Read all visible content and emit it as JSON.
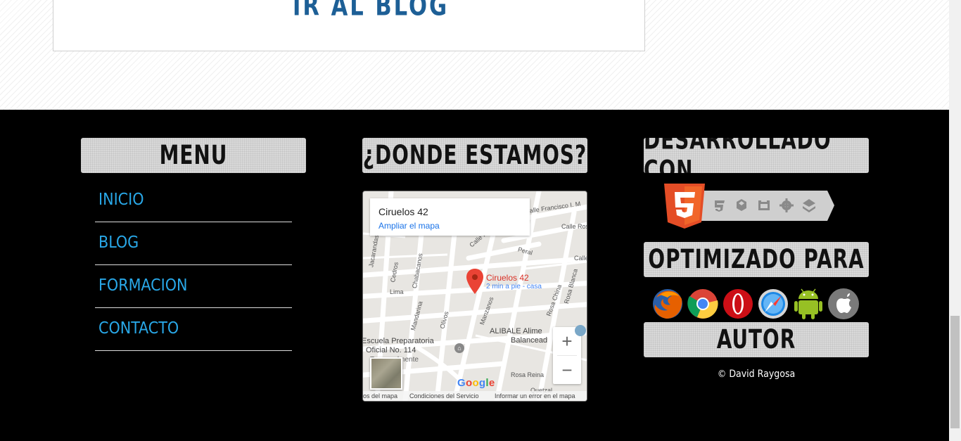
{
  "top_section": {
    "blog_link_label": "IR AL BLOG"
  },
  "footer": {
    "menu": {
      "heading": "MENU",
      "items": [
        {
          "label": "INICIO"
        },
        {
          "label": "BLOG"
        },
        {
          "label": "FORMACION"
        },
        {
          "label": "CONTACTO"
        }
      ]
    },
    "location": {
      "heading": "¿DONDE ESTAMOS?",
      "map": {
        "place_title": "Ciruelos 42",
        "enlarge_link": "Ampliar el mapa",
        "marker_label": "Ciruelos 42",
        "marker_sublabel": "2 min a pie - casa",
        "street_labels": [
          "Calle Francisco I. M",
          "Calle Ros",
          "Calle Rosa",
          "Peral",
          "Calle",
          "Cedros",
          "Chabacanos",
          "Lima",
          "Mandarina",
          "Olivos",
          "Manzanos",
          "Rosa China",
          "Rosa Blanca",
          "Rosa Reina",
          "Quetzal",
          "Jacarandas"
        ],
        "poi_school": [
          "Escuela Preparatoria",
          "Oficial No. 114",
          "Temporalmente"
        ],
        "poi_business": [
          "ALIBALE Alime",
          "Balancead"
        ],
        "zoom_in": "+",
        "zoom_out": "−",
        "footer_links": [
          "os del mapa",
          "Condiciones del Servicio",
          "Informar un error en el mapa"
        ],
        "google_logo": "Google"
      }
    },
    "tech": {
      "heading": "DESARROLLADO CON",
      "icons": [
        "html5-icon",
        "css3-icon",
        "device-icon",
        "semantics-icon",
        "gear-icon",
        "layers-icon"
      ]
    },
    "optimized": {
      "heading": "OPTIMIZADO PARA",
      "browsers": [
        "firefox-icon",
        "chrome-icon",
        "opera-icon",
        "safari-icon",
        "android-icon",
        "apple-icon"
      ]
    },
    "author": {
      "heading": "AUTOR",
      "copyright": "© David Raygosa"
    }
  },
  "colors": {
    "link_blue": "#29a8e8",
    "blog_title_blue": "#1d5f96",
    "footer_bg": "#000000",
    "heading_box_bg": "#d9d9d9",
    "html5_orange": "#e44d26"
  }
}
